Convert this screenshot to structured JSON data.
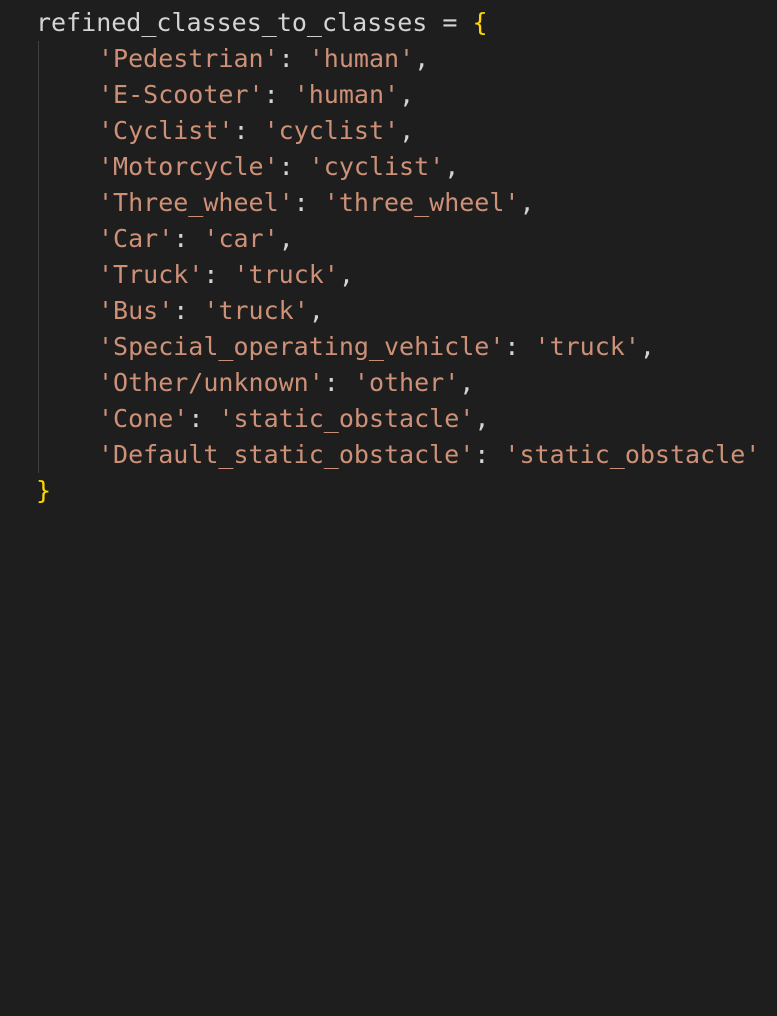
{
  "code": {
    "variable": "refined_classes_to_classes",
    "assign_op": "=",
    "open_brace": "{",
    "close_brace": "}",
    "entries": [
      {
        "key": "'Pedestrian'",
        "value": "'human'",
        "sep": ":",
        "trail": ","
      },
      {
        "key": "'E-Scooter'",
        "value": "'human'",
        "sep": ":",
        "trail": ","
      },
      {
        "key": "'Cyclist'",
        "value": "'cyclist'",
        "sep": ":",
        "trail": ","
      },
      {
        "key": "'Motorcycle'",
        "value": "'cyclist'",
        "sep": ":",
        "trail": ","
      },
      {
        "key": "'Three_wheel'",
        "value": "'three_wheel'",
        "sep": ":",
        "trail": ","
      },
      {
        "key": "'Car'",
        "value": "'car'",
        "sep": ":",
        "trail": ","
      },
      {
        "key": "'Truck'",
        "value": "'truck'",
        "sep": ":",
        "trail": ","
      },
      {
        "key": "'Bus'",
        "value": "'truck'",
        "sep": ":",
        "trail": ","
      },
      {
        "key": "'Special_operating_vehicle'",
        "value": "'truck'",
        "sep": ":",
        "trail": ","
      },
      {
        "key": "'Other/unknown'",
        "value": "'other'",
        "sep": ":",
        "trail": ","
      },
      {
        "key": "'Cone'",
        "value": "'static_obstacle'",
        "sep": ":",
        "trail": ","
      },
      {
        "key": "'Default_static_obstacle'",
        "value": "'static_obstacle'",
        "sep": ":",
        "trail": ""
      }
    ]
  },
  "colors": {
    "background": "#1e1e1e",
    "text": "#d4d4d4",
    "string": "#ce9178",
    "brace": "#ffd700",
    "indent_guide": "#404040"
  }
}
